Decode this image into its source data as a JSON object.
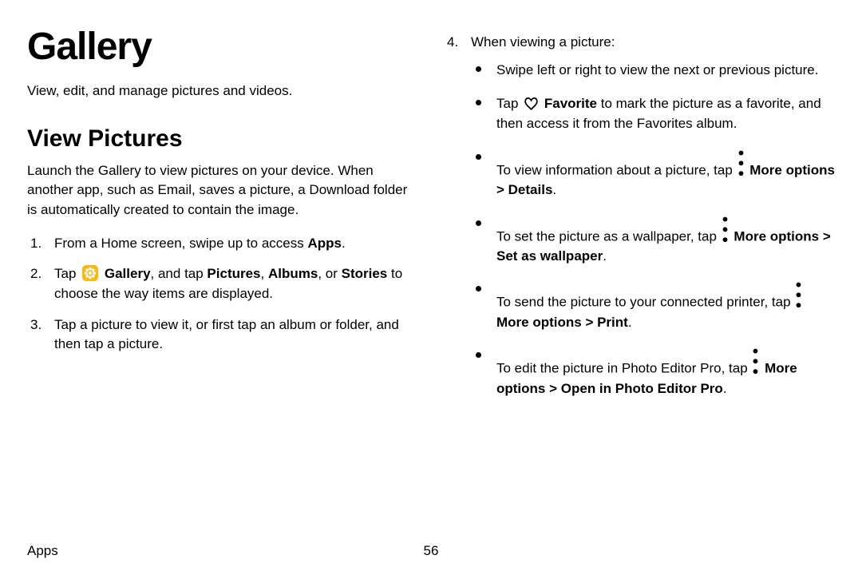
{
  "h1": "Gallery",
  "subtitle": "View, edit, and manage pictures and videos.",
  "h2": "View Pictures",
  "intro": "Launch the Gallery to view pictures on your device. When another app, such as Email, saves a picture, a Download folder is automatically created to contain the image.",
  "step1_a": "From a Home screen, swipe up to access ",
  "step1_b": "Apps",
  "step1_c": ".",
  "step2_a": "Tap ",
  "step2_b": "Gallery",
  "step2_c": ", and tap ",
  "step2_d": "Pictures",
  "step2_e": ", ",
  "step2_f": "Albums",
  "step2_g": ", or ",
  "step2_h": "Stories",
  "step2_i": " to choose the way items are displayed.",
  "step3": "Tap a picture to view it, or first tap an album or folder, and then tap a picture.",
  "step4": "When viewing a picture:",
  "b1": "Swipe left or right to view the next or previous picture.",
  "b2_a": "Tap ",
  "b2_b": "Favorite",
  "b2_c": " to mark the picture as a favorite, and then access it from the Favorites album.",
  "b3_a": "To view information about a picture, tap ",
  "b3_b": "More options",
  "b3_c": " > ",
  "b3_d": "Details",
  "b3_e": ".",
  "b4_a": "To set the picture as a wallpaper, tap ",
  "b4_b": "More options",
  "b4_c": " > ",
  "b4_d": "Set as wallpaper",
  "b4_e": ".",
  "b5_a": "To send the picture to your connected printer, tap ",
  "b5_b": "More options",
  "b5_c": " > ",
  "b5_d": "Print",
  "b5_e": ".",
  "b6_a": "To edit the picture in Photo Editor Pro, tap ",
  "b6_b": "More options",
  "b6_c": " > ",
  "b6_d": "Open in Photo Editor Pro",
  "b6_e": ".",
  "footer_section": "Apps",
  "footer_page": "56"
}
